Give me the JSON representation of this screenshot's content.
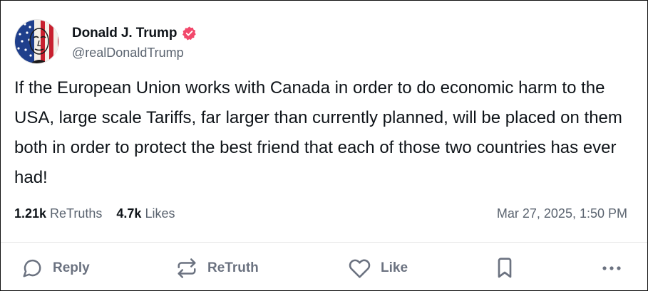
{
  "post": {
    "author": {
      "display_name": "Donald J. Trump",
      "handle": "@realDonaldTrump",
      "verified": true,
      "verified_color": "#f2486b"
    },
    "text": "If the European Union works with Canada in order to do economic harm to the USA, large scale Tariffs, far larger than currently planned, will be placed on them both in order to protect the best friend that each of those two countries has ever had!",
    "stats": {
      "retruths_count": "1.21k",
      "retruths_label": "ReTruths",
      "likes_count": "4.7k",
      "likes_label": "Likes"
    },
    "timestamp": "Mar 27, 2025, 1:50 PM"
  },
  "actions": {
    "reply_label": "Reply",
    "retruth_label": "ReTruth",
    "like_label": "Like"
  },
  "icons": {
    "reply": "chat-bubble-icon",
    "retruth": "repost-arrows-icon",
    "like": "heart-icon",
    "bookmark": "bookmark-icon",
    "more": "ellipsis-icon",
    "verified": "verified-badge-icon"
  },
  "colors": {
    "text_primary": "#0f1419",
    "text_secondary": "#5b6470",
    "action_gray": "#6b7280"
  }
}
